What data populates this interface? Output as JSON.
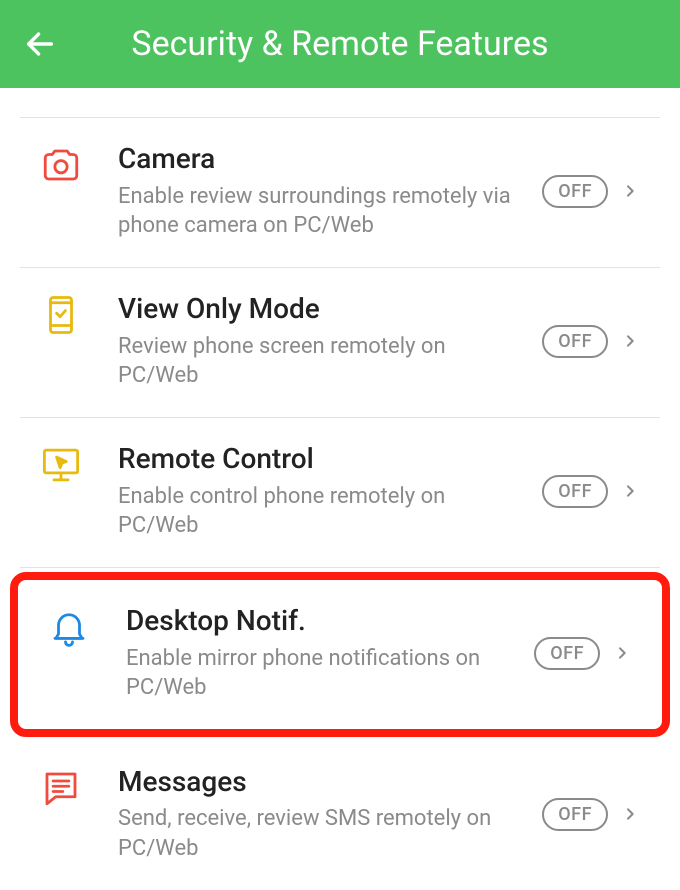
{
  "header": {
    "title": "Security & Remote Features"
  },
  "items": [
    {
      "title": "Camera",
      "desc": "Enable review surroundings remotely via phone camera on PC/Web",
      "badge": "OFF"
    },
    {
      "title": "View Only Mode",
      "desc": "Review phone screen remotely on PC/Web",
      "badge": "OFF"
    },
    {
      "title": "Remote Control",
      "desc": "Enable control phone remotely on PC/Web",
      "badge": "OFF"
    },
    {
      "title": "Desktop Notif.",
      "desc": "Enable mirror phone notifications on PC/Web",
      "badge": "OFF"
    },
    {
      "title": "Messages",
      "desc": "Send, receive, review SMS remotely on PC/Web",
      "badge": "OFF"
    }
  ],
  "colors": {
    "accent": "#4CC35F",
    "highlight": "#FF1B0E"
  }
}
